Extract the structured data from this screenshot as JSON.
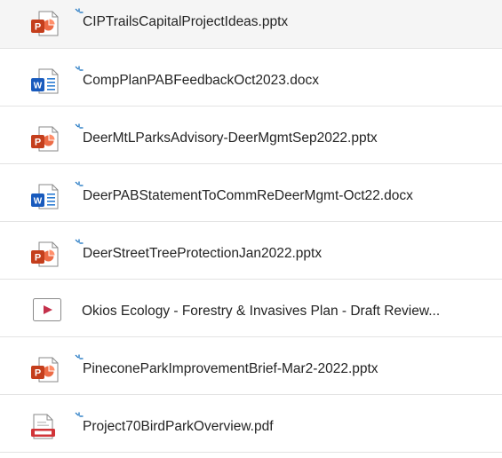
{
  "accent_color": "#0f6cbd",
  "files": [
    {
      "name": "CIPTrailsCapitalProjectIdeas.pptx",
      "icon": "powerpoint-icon",
      "is_new": true
    },
    {
      "name": "CompPlanPABFeedbackOct2023.docx",
      "icon": "word-icon",
      "is_new": true
    },
    {
      "name": "DeerMtLParksAdvisory-DeerMgmtSep2022.pptx",
      "icon": "powerpoint-icon",
      "is_new": true
    },
    {
      "name": "DeerPABStatementToCommReDeerMgmt-Oct22.docx",
      "icon": "word-icon",
      "is_new": true
    },
    {
      "name": "DeerStreetTreeProtectionJan2022.pptx",
      "icon": "powerpoint-icon",
      "is_new": true
    },
    {
      "name": "Okios Ecology - Forestry & Invasives Plan - Draft Review...",
      "icon": "video-icon",
      "is_new": false
    },
    {
      "name": "PineconeParkImprovementBrief-Mar2-2022.pptx",
      "icon": "powerpoint-icon",
      "is_new": true
    },
    {
      "name": "Project70BirdParkOverview.pdf",
      "icon": "pdf-icon",
      "is_new": true
    }
  ]
}
